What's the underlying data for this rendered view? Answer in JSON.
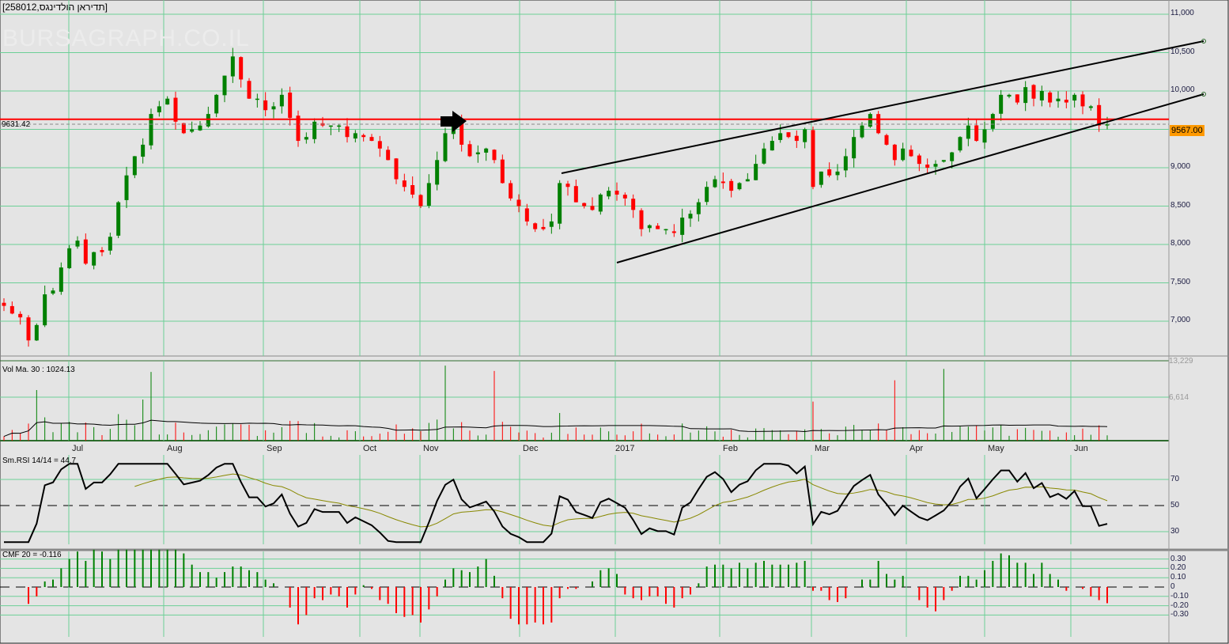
{
  "title": "[258012,תדיראן הולדינגס]",
  "watermark": "BURSAGRAPH.CO.IL",
  "colors": {
    "up": "#008000",
    "down": "#ff0000",
    "grid": "#6ccf96",
    "bg": "#e4e4e4",
    "last_price_bg": "#ff9900"
  },
  "reference_label": "9631.42",
  "last_price_label": "9567.00",
  "panels": {
    "volume_label": "Vol Ma. 30 : 1024.13",
    "rsi_label": "Sm.RSI 14/14 = 44.7",
    "cmf_label": "CMF 20 = -0.116"
  },
  "chart_data": {
    "type": "candlestick",
    "title": "[258012,תדיראן הולדינגס]",
    "price_axis": {
      "ticks": [
        "11,000",
        "10,500",
        "10,000",
        "9,000",
        "8,500",
        "8,000",
        "7,500",
        "7,000"
      ],
      "ylim": [
        6550,
        11150
      ]
    },
    "volume_axis": {
      "ticks": [
        "13,229",
        "6,614"
      ],
      "max": 13229
    },
    "rsi_axis": {
      "ticks": [
        "70",
        "50",
        "30"
      ]
    },
    "cmf_axis": {
      "ticks": [
        "0.30",
        "0.20",
        "0.10",
        "0",
        "-0.10",
        "-0.20",
        "-0.30"
      ]
    },
    "months": [
      "Jul",
      "Aug",
      "Sep",
      "Oct",
      "Nov",
      "Dec",
      "2017",
      "Feb",
      "Mar",
      "Apr",
      "May",
      "Jun"
    ],
    "reference_level": 9631.42,
    "last_price": 9567,
    "closes": [
      7200,
      7100,
      7050,
      6750,
      6950,
      7350,
      7400,
      7700,
      7950,
      8050,
      7750,
      7900,
      7900,
      8100,
      8550,
      8900,
      9150,
      9300,
      9700,
      9800,
      9900,
      9600,
      9450,
      9500,
      9550,
      9700,
      9950,
      10200,
      10450,
      10150,
      9900,
      9900,
      9750,
      9800,
      9950,
      9650,
      9350,
      9400,
      9600,
      9550,
      9550,
      9550,
      9400,
      9450,
      9400,
      9350,
      9250,
      9100,
      8850,
      8750,
      8650,
      8500,
      8800,
      9100,
      9450,
      9600,
      9300,
      9150,
      9200,
      9250,
      9100,
      8800,
      8600,
      8500,
      8300,
      8200,
      8200,
      8300,
      8800,
      8750,
      8550,
      8500,
      8450,
      8650,
      8700,
      8650,
      8600,
      8450,
      8200,
      8250,
      8200,
      8200,
      8150,
      8350,
      8400,
      8550,
      8750,
      8850,
      8800,
      8700,
      8800,
      8850,
      9050,
      9250,
      9350,
      9450,
      9400,
      9350,
      9500,
      8750,
      8950,
      8900,
      8950,
      9150,
      9400,
      9550,
      9700,
      9450,
      9300,
      9100,
      9250,
      9150,
      9050,
      9000,
      9050,
      9100,
      9200,
      9400,
      9550,
      9350,
      9500,
      9700,
      9950,
      9950,
      9850,
      10050,
      9900,
      10000,
      9850,
      9900,
      9850,
      9950,
      9800,
      9800,
      9550,
      9567
    ],
    "trendlines": [
      {
        "name": "upper-channel",
        "from": [
          "Nov-end",
          8950
        ],
        "to": [
          "Jul-2017",
          10620
        ]
      },
      {
        "name": "lower-channel",
        "from": [
          "Dec-end",
          7770
        ],
        "to": [
          "Jul-2017",
          9950
        ]
      }
    ]
  }
}
